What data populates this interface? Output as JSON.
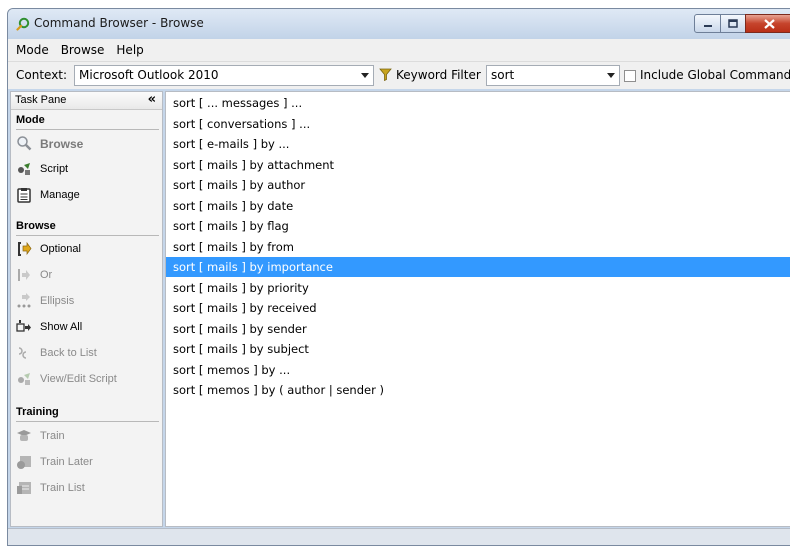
{
  "window": {
    "title": "Command Browser - Browse",
    "buttons": {
      "minimize": "minimize",
      "maximize": "maximize",
      "close": "close"
    }
  },
  "menu": [
    "Mode",
    "Browse",
    "Help"
  ],
  "toolbar": {
    "context_label": "Context:",
    "context_value": "Microsoft Outlook 2010",
    "filter_label": "Keyword Filter",
    "filter_value": "sort",
    "global_label": "Include Global Commands",
    "global_checked": false
  },
  "task_pane": {
    "title": "Task Pane",
    "collapse_glyph": "«",
    "sections": [
      {
        "title": "Mode",
        "items": [
          {
            "label": "Browse",
            "icon": "magnifier-icon",
            "state": "active"
          },
          {
            "label": "Script",
            "icon": "script-icon",
            "state": "enabled"
          },
          {
            "label": "Manage",
            "icon": "manage-icon",
            "state": "enabled"
          }
        ]
      },
      {
        "title": "Browse",
        "items": [
          {
            "label": "Optional",
            "icon": "optional-icon",
            "state": "enabled"
          },
          {
            "label": "Or",
            "icon": "or-icon",
            "state": "disabled"
          },
          {
            "label": "Ellipsis",
            "icon": "ellipsis-icon",
            "state": "disabled"
          },
          {
            "label": "Show All",
            "icon": "show-all-icon",
            "state": "enabled"
          },
          {
            "label": "Back to List",
            "icon": "back-to-list-icon",
            "state": "disabled"
          },
          {
            "label": "View/Edit Script",
            "icon": "view-edit-script-icon",
            "state": "disabled"
          }
        ]
      },
      {
        "title": "Training",
        "items": [
          {
            "label": "Train",
            "icon": "train-icon",
            "state": "disabled"
          },
          {
            "label": "Train Later",
            "icon": "train-later-icon",
            "state": "disabled"
          },
          {
            "label": "Train List",
            "icon": "train-list-icon",
            "state": "disabled"
          }
        ]
      }
    ]
  },
  "commands": [
    "sort [ ... messages ] ...",
    "sort [ conversations ] ...",
    "sort [ e-mails ] by ...",
    "sort [ mails ] by attachment",
    "sort [ mails ] by author",
    "sort [ mails ] by date",
    "sort [ mails ] by flag",
    "sort [ mails ] by from",
    "sort [ mails ] by importance",
    "sort [ mails ] by priority",
    "sort [ mails ] by received",
    "sort [ mails ] by sender",
    "sort [ mails ] by subject",
    "sort [ memos ] by ...",
    "sort [ memos ] by ( author | sender )"
  ],
  "selected_command_index": 8,
  "colors": {
    "selection": "#3399ff",
    "close_button": "#c6442c",
    "title_gradient_top": "#dfe9f5"
  }
}
